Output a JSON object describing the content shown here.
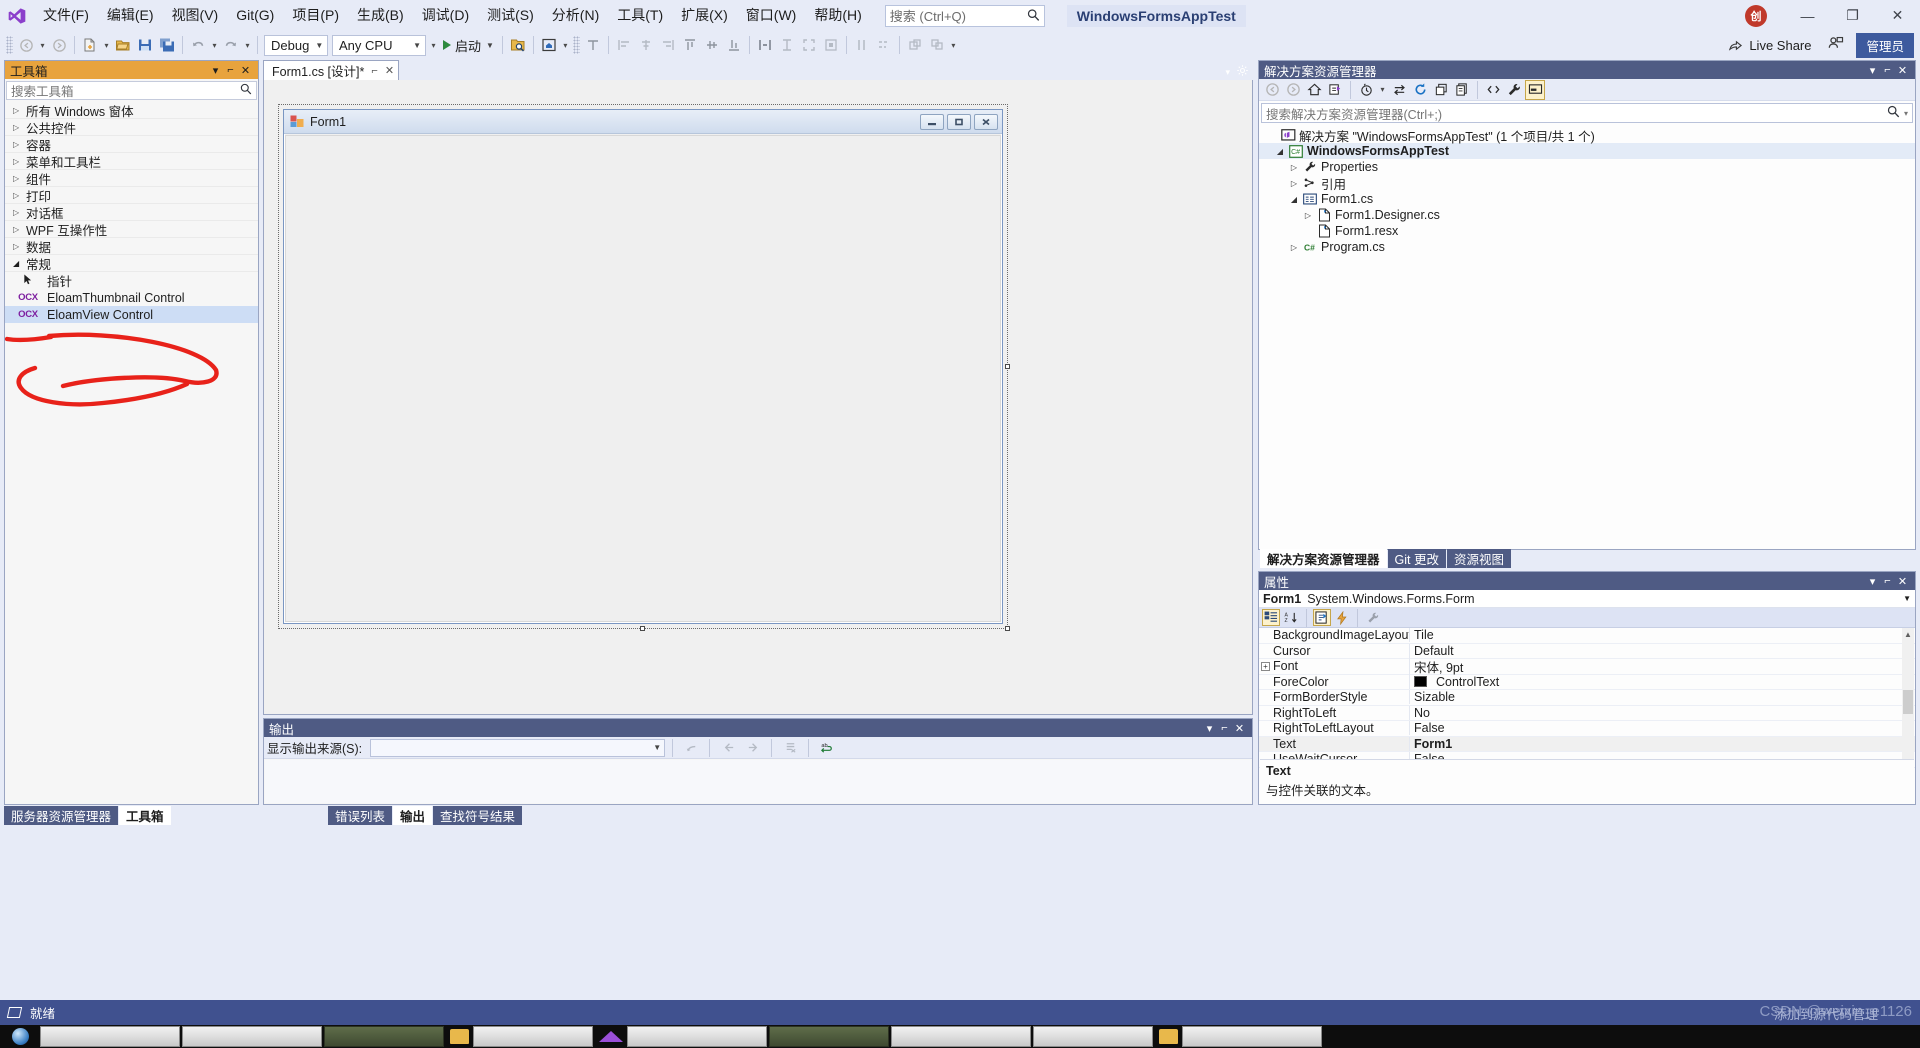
{
  "app": {
    "solution_title": "WindowsFormsAppTest",
    "user_initial": "创"
  },
  "menu": {
    "items": [
      {
        "label": "文件(F)"
      },
      {
        "label": "编辑(E)"
      },
      {
        "label": "视图(V)"
      },
      {
        "label": "Git(G)"
      },
      {
        "label": "项目(P)"
      },
      {
        "label": "生成(B)"
      },
      {
        "label": "调试(D)"
      },
      {
        "label": "测试(S)"
      },
      {
        "label": "分析(N)"
      },
      {
        "label": "工具(T)"
      },
      {
        "label": "扩展(X)"
      },
      {
        "label": "窗口(W)"
      },
      {
        "label": "帮助(H)"
      }
    ],
    "search_placeholder": "搜索 (Ctrl+Q)"
  },
  "toolbar": {
    "configuration": "Debug",
    "platform": "Any CPU",
    "run_label": "启动",
    "live_share_label": "Live Share",
    "admin_label": "管理员"
  },
  "window_controls": {
    "minimize": "—",
    "restore": "❐",
    "close": "✕"
  },
  "toolbox": {
    "title": "工具箱",
    "search_placeholder": "搜索工具箱",
    "groups": [
      {
        "label": "所有 Windows 窗体",
        "expanded": false
      },
      {
        "label": "公共控件",
        "expanded": false
      },
      {
        "label": "容器",
        "expanded": false
      },
      {
        "label": "菜单和工具栏",
        "expanded": false
      },
      {
        "label": "组件",
        "expanded": false
      },
      {
        "label": "打印",
        "expanded": false
      },
      {
        "label": "对话框",
        "expanded": false
      },
      {
        "label": "WPF 互操作性",
        "expanded": false
      },
      {
        "label": "数据",
        "expanded": false
      },
      {
        "label": "常规",
        "expanded": true
      }
    ],
    "items": [
      {
        "label": "指针",
        "icon": "pointer-icon",
        "selected": false
      },
      {
        "label": "EloamThumbnail Control",
        "icon": "ocx-icon",
        "selected": false
      },
      {
        "label": "EloamView Control",
        "icon": "ocx-icon",
        "selected": true
      }
    ]
  },
  "left_dock_tabs": [
    {
      "label": "服务器资源管理器",
      "active": false
    },
    {
      "label": "工具箱",
      "active": true
    }
  ],
  "document": {
    "tab_label": "Form1.cs [设计]*",
    "form": {
      "title": "Form1",
      "minimize": "–",
      "maximize": "□",
      "close": "✕"
    }
  },
  "output": {
    "title": "输出",
    "source_label": "显示输出来源(S):",
    "source_value": "",
    "body_text": ""
  },
  "bottom_dock_tabs": [
    {
      "label": "错误列表",
      "active": false
    },
    {
      "label": "输出",
      "active": true
    },
    {
      "label": "查找符号结果",
      "active": false
    }
  ],
  "solution_explorer": {
    "title": "解决方案资源管理器",
    "search_placeholder": "搜索解决方案资源管理器(Ctrl+;)",
    "tree": [
      {
        "label": "解决方案 \"WindowsFormsAppTest\" (1 个项目/共 1 个)",
        "indent": 0,
        "expander": "",
        "icon": "solution-icon",
        "bold": false,
        "selected": false
      },
      {
        "label": "WindowsFormsAppTest",
        "indent": 1,
        "expander": "open",
        "icon": "csharp-project-icon",
        "bold": true,
        "selected": true
      },
      {
        "label": "Properties",
        "indent": 2,
        "expander": "closed",
        "icon": "wrench-icon",
        "bold": false,
        "selected": false
      },
      {
        "label": "引用",
        "indent": 2,
        "expander": "closed",
        "icon": "references-icon",
        "bold": false,
        "selected": false
      },
      {
        "label": "Form1.cs",
        "indent": 2,
        "expander": "open",
        "icon": "form-icon",
        "bold": false,
        "selected": false
      },
      {
        "label": "Form1.Designer.cs",
        "indent": 3,
        "expander": "closed",
        "icon": "csharp-file-icon",
        "bold": false,
        "selected": false
      },
      {
        "label": "Form1.resx",
        "indent": 3,
        "expander": "",
        "icon": "csharp-file-icon",
        "bold": false,
        "selected": false
      },
      {
        "label": "Program.cs",
        "indent": 2,
        "expander": "closed",
        "icon": "csharp-icon",
        "bold": false,
        "selected": false
      }
    ]
  },
  "right_dock_tabs": [
    {
      "label": "解决方案资源管理器",
      "active": true
    },
    {
      "label": "Git 更改",
      "active": false
    },
    {
      "label": "资源视图",
      "active": false
    }
  ],
  "properties": {
    "title": "属性",
    "object_name": "Form1",
    "object_type": "System.Windows.Forms.Form",
    "rows": [
      {
        "key": "BackgroundImageLayout",
        "value": "Tile",
        "expander": "",
        "swatch": "",
        "bold": false,
        "selected": false
      },
      {
        "key": "Cursor",
        "value": "Default",
        "expander": "",
        "swatch": "",
        "bold": false,
        "selected": false
      },
      {
        "key": "Font",
        "value": "宋体, 9pt",
        "expander": "+",
        "swatch": "",
        "bold": false,
        "selected": false
      },
      {
        "key": "ForeColor",
        "value": "ControlText",
        "expander": "",
        "swatch": "#000000",
        "bold": false,
        "selected": false
      },
      {
        "key": "FormBorderStyle",
        "value": "Sizable",
        "expander": "",
        "swatch": "",
        "bold": false,
        "selected": false
      },
      {
        "key": "RightToLeft",
        "value": "No",
        "expander": "",
        "swatch": "",
        "bold": false,
        "selected": false
      },
      {
        "key": "RightToLeftLayout",
        "value": "False",
        "expander": "",
        "swatch": "",
        "bold": false,
        "selected": false
      },
      {
        "key": "Text",
        "value": "Form1",
        "expander": "",
        "swatch": "",
        "bold": true,
        "selected": true
      },
      {
        "key": "UseWaitCursor",
        "value": "False",
        "expander": "",
        "swatch": "",
        "bold": false,
        "selected": false
      }
    ],
    "description_title": "Text",
    "description_text": "与控件关联的文本。"
  },
  "status": {
    "text": "就绪",
    "watermark": "CSDN @weixin_e1126",
    "watermark_overlay": "添加到源代码管理"
  },
  "colors": {
    "accent": "#4f5b84",
    "toolbox_header": "#e8a33d",
    "selection": "#cdddf5",
    "status_bar": "#40518f",
    "annotation": "#e8221a"
  }
}
